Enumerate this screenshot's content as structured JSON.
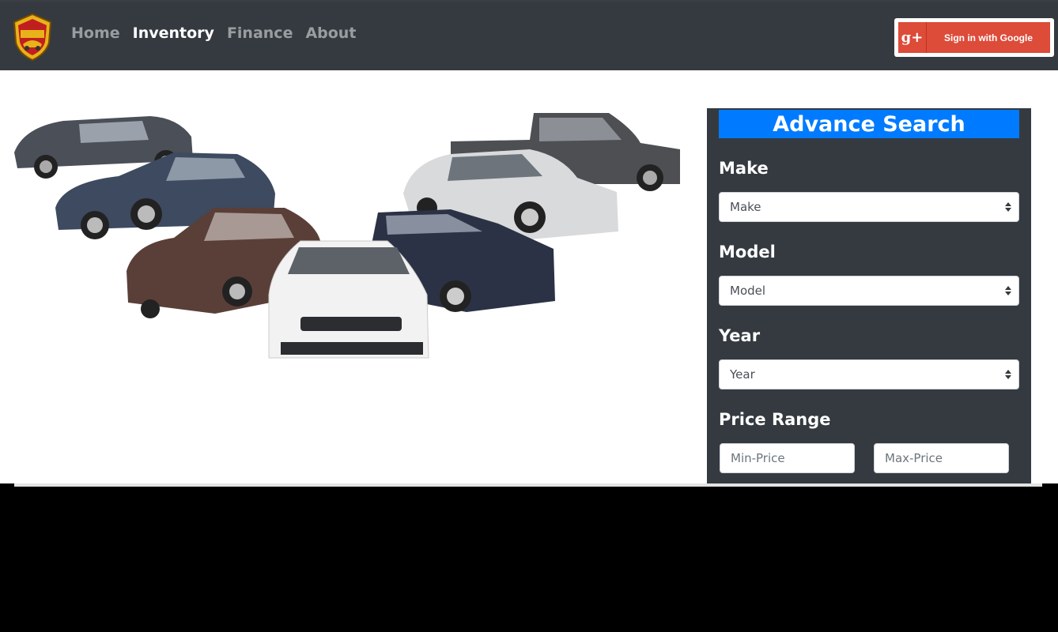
{
  "nav": {
    "links": [
      {
        "label": "Home",
        "active": false
      },
      {
        "label": "Inventory",
        "active": true
      },
      {
        "label": "Finance",
        "active": false
      },
      {
        "label": "About",
        "active": false
      }
    ],
    "google_button": {
      "icon_text": "g+",
      "label": "Sign in with Google"
    }
  },
  "search": {
    "title": "Advance Search",
    "make": {
      "label": "Make",
      "selected": "Make"
    },
    "model": {
      "label": "Model",
      "selected": "Model"
    },
    "year": {
      "label": "Year",
      "selected": "Year"
    },
    "price": {
      "label": "Price Range",
      "min_placeholder": "Min-Price",
      "max_placeholder": "Max-Price"
    }
  },
  "colors": {
    "navbar": "#343a40",
    "accent": "#007bff",
    "google": "#dd4b39"
  }
}
